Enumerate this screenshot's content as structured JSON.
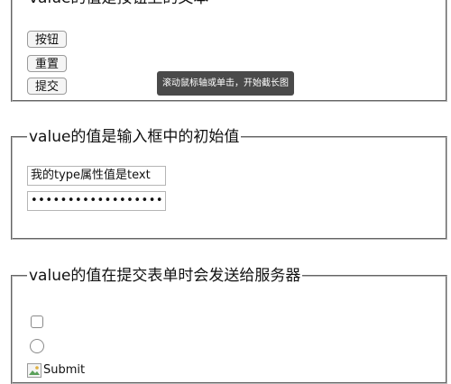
{
  "section1": {
    "legend": "value的值是按钮上的文本",
    "buttons": [
      "按钮",
      "重置",
      "提交"
    ]
  },
  "tooltip": "滚动鼠标轴或单击，开始截长图",
  "section2": {
    "legend": "value的值是输入框中的初始值",
    "text_input_value": "我的type属性值是text",
    "password_mask": "••••••••••••••••••"
  },
  "section3": {
    "legend": "value的值在提交表单时会发送给服务器",
    "checkbox_checked": false,
    "radio_checked": false,
    "image_alt": "Submit"
  }
}
